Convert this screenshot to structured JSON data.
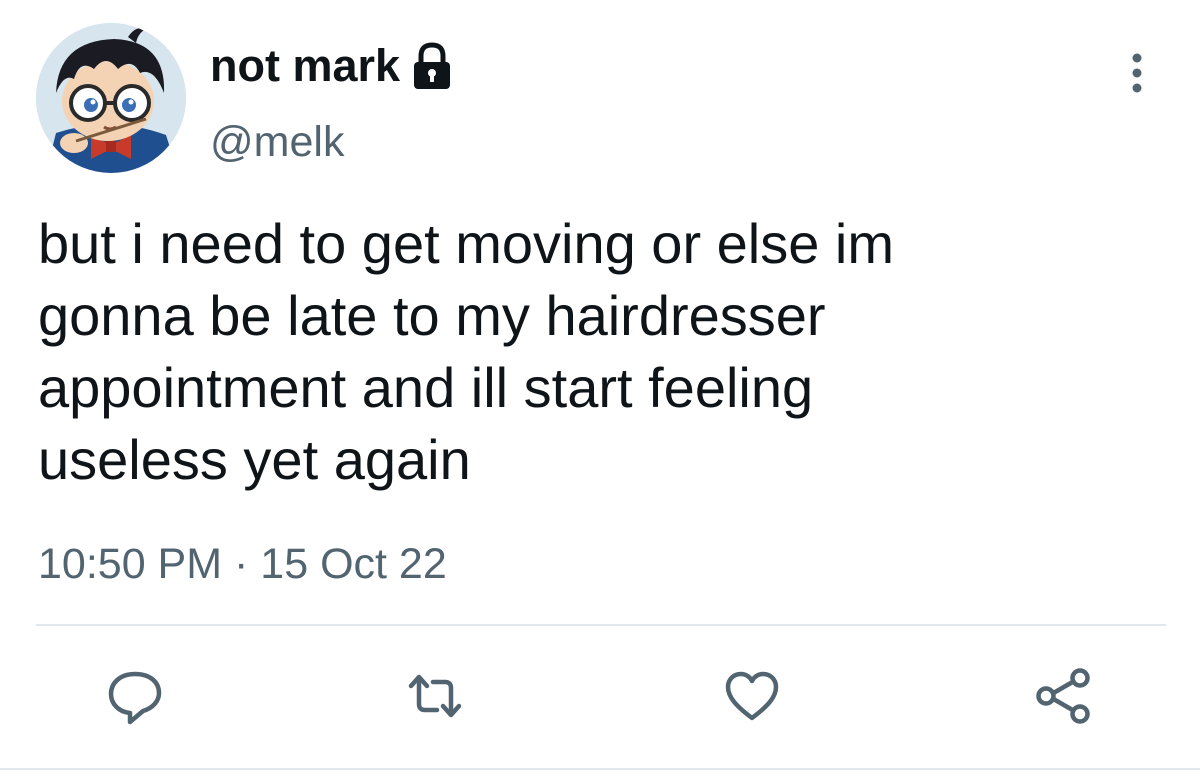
{
  "tweet": {
    "author": {
      "display_name": "not mark",
      "handle": "@melk",
      "protected_icon": "lock-icon",
      "avatar": "anime-character-avatar"
    },
    "text": "but i need to get moving or else im\ngonna be late to my hairdresser\nappointment and ill start feeling\nuseless yet again",
    "time": "10:50 PM",
    "separator": "·",
    "date": "15 Oct 22",
    "menu_icon": "more-vertical-icon"
  },
  "actions": [
    {
      "name": "reply",
      "icon": "comment-icon"
    },
    {
      "name": "retweet",
      "icon": "retweet-icon"
    },
    {
      "name": "like",
      "icon": "heart-icon"
    },
    {
      "name": "share",
      "icon": "share-icon"
    }
  ],
  "colors": {
    "text_primary": "#0f1419",
    "text_secondary": "#536471",
    "icon": "#536471",
    "divider": "#e3e8ec",
    "background": "#ffffff"
  }
}
